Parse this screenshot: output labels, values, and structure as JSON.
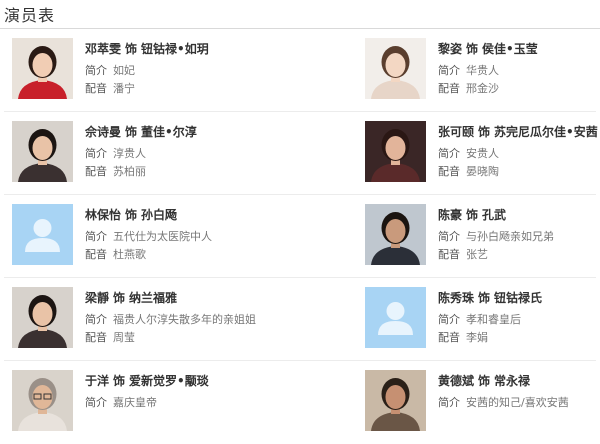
{
  "section": {
    "title": "演员表"
  },
  "labels": {
    "role_connector": "饰",
    "intro": "简介",
    "dub": "配音"
  },
  "colors": {
    "placeholder_bg": "#a8d4f4",
    "placeholder_fg": "#e8f4fd"
  },
  "cast": [
    {
      "actor": "邓萃雯",
      "character": "钮钴禄•如玥",
      "intro": "如妃",
      "dub": "潘宁",
      "photo": "portrait-red-outfit"
    },
    {
      "actor": "黎姿",
      "character": "侯佳•玉莹",
      "intro": "华贵人",
      "dub": "邢金沙",
      "photo": "portrait-light"
    },
    {
      "actor": "佘诗曼",
      "character": "董佳•尔淳",
      "intro": "淳贵人",
      "dub": "苏柏丽",
      "photo": "portrait-dark-hair"
    },
    {
      "actor": "张可颐",
      "character": "苏完尼瓜尔佳•安茜",
      "intro": "安贵人",
      "dub": "晏晓陶",
      "photo": "portrait-dark-bg"
    },
    {
      "actor": "林保怡",
      "character": "孙白飏",
      "intro": "五代仕为太医院中人",
      "dub": "杜燕歌",
      "photo": "placeholder-avatar"
    },
    {
      "actor": "陈豪",
      "character": "孔武",
      "intro": "与孙白飏亲如兄弟",
      "dub": "张艺",
      "photo": "portrait-suit"
    },
    {
      "actor": "梁靜",
      "character": "纳兰福雅",
      "intro": "福贵人尔淳失散多年的亲姐姐",
      "dub": "周莹",
      "photo": "portrait-dark-hair"
    },
    {
      "actor": "陈秀珠",
      "character": "钮钴禄氏",
      "intro": "孝和睿皇后",
      "dub": "李娟",
      "photo": "placeholder-avatar"
    },
    {
      "actor": "于洋",
      "character": "爱新觉罗•颙琰",
      "intro": "嘉庆皇帝",
      "photo": "portrait-glasses"
    },
    {
      "actor": "黄德斌",
      "character": "常永禄",
      "intro": "安茜的知己/喜欢安茜",
      "photo": "portrait-man"
    }
  ]
}
